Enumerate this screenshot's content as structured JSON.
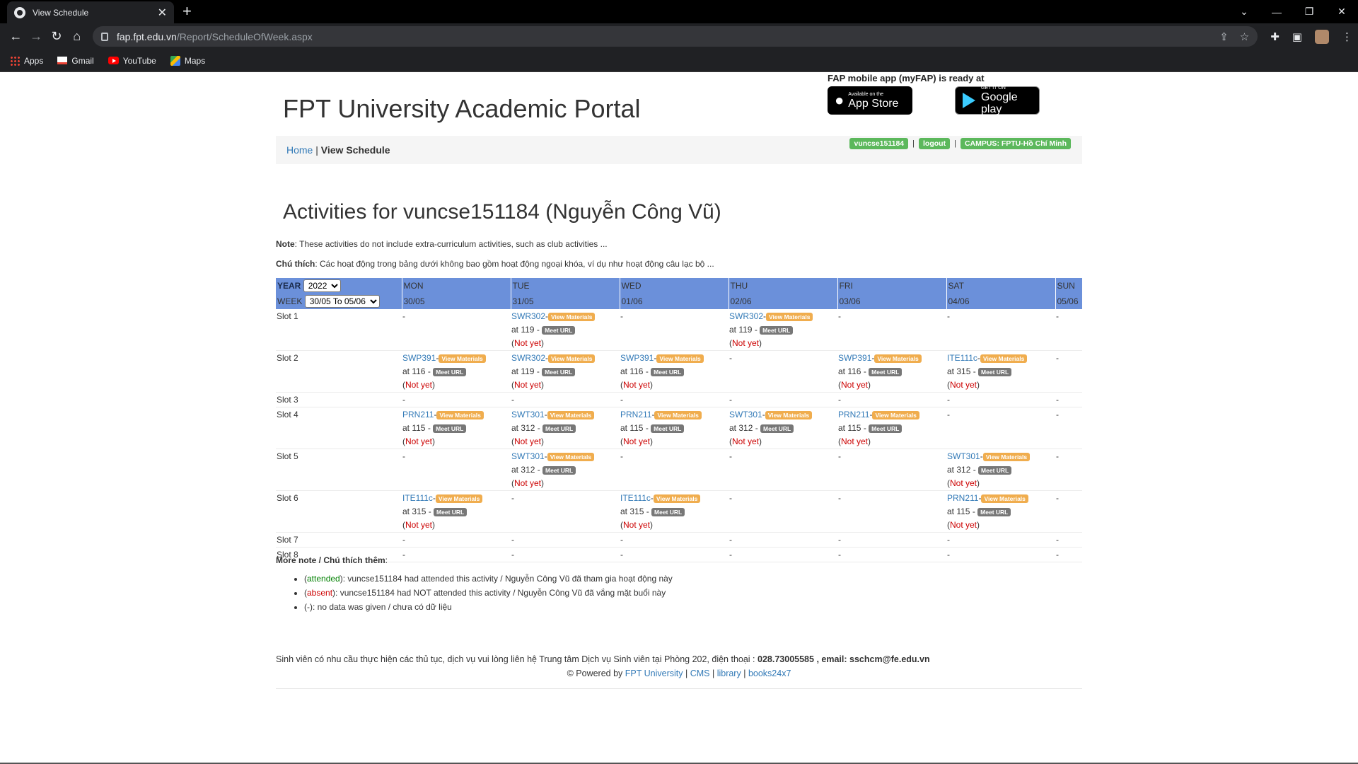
{
  "browser": {
    "tab_title": "View Schedule",
    "new_tab": "+",
    "url_domain": "fap.fpt.edu.vn",
    "url_path": "/Report/ScheduleOfWeek.aspx",
    "bookmarks": [
      "Apps",
      "Gmail",
      "YouTube",
      "Maps"
    ]
  },
  "header": {
    "promo_text": "FAP mobile app (myFAP) is ready at",
    "appstore_small": "Available on the",
    "appstore_big": "App Store",
    "googleplay_small": "GET IT ON",
    "googleplay_big": "Google play",
    "site_title": "FPT University Academic Portal"
  },
  "breadcrumb": {
    "home": "Home",
    "sep": "|",
    "current": "View Schedule"
  },
  "user": {
    "username": "vuncse151184",
    "logout": "logout",
    "campus": "CAMPUS: FPTU-Hồ Chí Minh",
    "sep": "|"
  },
  "main": {
    "title": "Activities for vuncse151184 (Nguyễn Công Vũ)",
    "note_label": "Note",
    "note_text": ": These activities do not include extra-curriculum activities, such as club activities ...",
    "note_vi_label": "Chú thích",
    "note_vi_text": ": Các hoạt động trong bảng dưới không bao gồm hoạt động ngoại khóa, ví dụ như hoạt động câu lạc bộ ..."
  },
  "schedule": {
    "year_label": "YEAR",
    "year_value": "2022",
    "week_label": "WEEK",
    "week_value": "30/05 To 05/06",
    "days": [
      "MON",
      "TUE",
      "WED",
      "THU",
      "FRI",
      "SAT",
      "SUN"
    ],
    "dates": [
      "30/05",
      "31/05",
      "01/06",
      "02/06",
      "03/06",
      "04/06",
      "05/06"
    ],
    "materials_label": "View Materials",
    "meet_label": "Meet URL",
    "not_yet": "Not yet",
    "slots": [
      {
        "name": "Slot 1",
        "cells": [
          null,
          {
            "code": "SWR302",
            "room": "119"
          },
          null,
          {
            "code": "SWR302",
            "room": "119"
          },
          null,
          null,
          null
        ]
      },
      {
        "name": "Slot 2",
        "cells": [
          {
            "code": "SWP391",
            "room": "116"
          },
          {
            "code": "SWR302",
            "room": "119"
          },
          {
            "code": "SWP391",
            "room": "116"
          },
          null,
          {
            "code": "SWP391",
            "room": "116"
          },
          {
            "code": "ITE111c",
            "room": "315"
          },
          null
        ]
      },
      {
        "name": "Slot 3",
        "cells": [
          null,
          null,
          null,
          null,
          null,
          null,
          null
        ]
      },
      {
        "name": "Slot 4",
        "cells": [
          {
            "code": "PRN211",
            "room": "115"
          },
          {
            "code": "SWT301",
            "room": "312"
          },
          {
            "code": "PRN211",
            "room": "115"
          },
          {
            "code": "SWT301",
            "room": "312"
          },
          {
            "code": "PRN211",
            "room": "115"
          },
          null,
          null
        ]
      },
      {
        "name": "Slot 5",
        "cells": [
          null,
          {
            "code": "SWT301",
            "room": "312"
          },
          null,
          null,
          null,
          {
            "code": "SWT301",
            "room": "312"
          },
          null
        ]
      },
      {
        "name": "Slot 6",
        "cells": [
          {
            "code": "ITE111c",
            "room": "315"
          },
          null,
          {
            "code": "ITE111c",
            "room": "315"
          },
          null,
          null,
          {
            "code": "PRN211",
            "room": "115"
          },
          null
        ]
      },
      {
        "name": "Slot 7",
        "cells": [
          null,
          null,
          null,
          null,
          null,
          null,
          null
        ]
      },
      {
        "name": "Slot 8",
        "cells": [
          null,
          null,
          null,
          null,
          null,
          null,
          null
        ]
      }
    ]
  },
  "more_note": {
    "title": "More note / Chú thích thêm",
    "attended_word": "attended",
    "attended_text": "): vuncse151184 had attended this activity / Nguyễn Công Vũ đã tham gia hoạt động này",
    "absent_word": "absent",
    "absent_text": "): vuncse151184 had NOT attended this activity / Nguyễn Công Vũ đã vắng mặt buổi này",
    "dash_text": "(-): no data was given / chưa có dữ liệu"
  },
  "footer": {
    "contact": "Sinh viên có nhu cầu thực hiện các thủ tục, dịch vụ vui lòng liên hệ Trung tâm Dịch vụ Sinh viên tại Phòng 202, điện thoại : ",
    "phone": "028.73005585",
    "email_label": ", email: sschcm@fe.edu.vn",
    "powered": "© Powered by ",
    "links": [
      "FPT University",
      "CMS",
      "library",
      "books24x7"
    ]
  }
}
